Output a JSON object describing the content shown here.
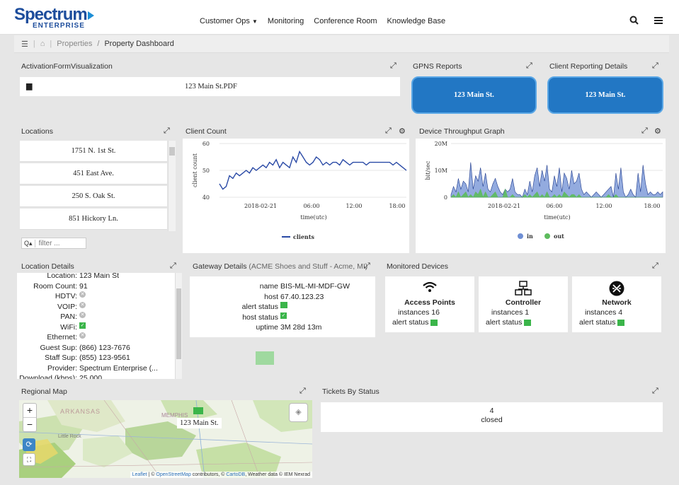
{
  "header": {
    "logo_top": "Spectrum",
    "logo_bottom": "ENTERPRISE",
    "nav": [
      "Customer Ops",
      "Monitoring",
      "Conference Room",
      "Knowledge Base"
    ],
    "search_icon": "search-icon",
    "menu_icon": "hamburger-menu-icon"
  },
  "breadcrumb": {
    "home_icon": "home-icon",
    "item1": "Properties",
    "sep": "/",
    "current": "Property Dashboard"
  },
  "activation": {
    "title": "ActivationFormVisualization",
    "file": "123 Main St.PDF"
  },
  "gpns": {
    "title": "GPNS Reports",
    "button": "123 Main St."
  },
  "client_reporting": {
    "title": "Client Reporting Details",
    "button": "123 Main St."
  },
  "locations": {
    "title": "Locations",
    "items": [
      "1751 N. 1st St.",
      "451 East Ave.",
      "250 S. Oak St.",
      "851 Hickory Ln."
    ],
    "filter_placeholder": "filter ..."
  },
  "client_count": {
    "title": "Client Count"
  },
  "throughput": {
    "title": "Device Throughput Graph"
  },
  "chart_data": [
    {
      "type": "line",
      "title": "Client Count",
      "xlabel": "time(utc)",
      "ylabel": "client count",
      "x_ticks": [
        "2018-02-21",
        "06:00",
        "12:00",
        "18:00"
      ],
      "y_ticks": [
        "40",
        "50",
        "60"
      ],
      "ylim": [
        40,
        60
      ],
      "series": [
        {
          "name": "clients",
          "color": "#2a4aa6",
          "values": [
            45,
            43,
            44,
            48,
            47,
            49,
            48,
            49,
            50,
            49,
            51,
            50,
            51,
            52,
            51,
            53,
            52,
            54,
            51,
            53,
            52,
            51,
            55,
            53,
            57,
            55,
            53,
            52,
            53,
            55,
            54,
            52,
            53,
            52,
            53,
            53,
            52,
            54,
            53,
            52,
            53,
            53,
            53,
            53,
            52,
            53,
            53,
            53,
            53,
            53,
            53,
            53,
            52,
            53,
            52,
            51,
            50
          ]
        }
      ],
      "legend": "bottom"
    },
    {
      "type": "area",
      "title": "Device Throughput Graph",
      "xlabel": "time(utc)",
      "ylabel": "bit/sec",
      "x_ticks": [
        "2018-02-21",
        "06:00",
        "12:00",
        "18:00"
      ],
      "y_ticks": [
        "0",
        "10M",
        "20M"
      ],
      "ylim": [
        0,
        20
      ],
      "series": [
        {
          "name": "in",
          "color": "#6f8fd4",
          "values": [
            1,
            4,
            2,
            7,
            3,
            6,
            5,
            2,
            13,
            3,
            8,
            6,
            11,
            4,
            9,
            3,
            2,
            5,
            7,
            4,
            2,
            1,
            3,
            2,
            3,
            7,
            2,
            1,
            1,
            0,
            3,
            1,
            6,
            2,
            8,
            11,
            4,
            10,
            6,
            12,
            3,
            2,
            8,
            4,
            11,
            2,
            9,
            7,
            3,
            10,
            5,
            6,
            9,
            3,
            1,
            2,
            1,
            0,
            1,
            2,
            1,
            0,
            1,
            2,
            3,
            4,
            0,
            9,
            3,
            11,
            2,
            0,
            1,
            3,
            1,
            0,
            9,
            2,
            12,
            5,
            1,
            2,
            1,
            1,
            2,
            1,
            2
          ]
        },
        {
          "name": "out",
          "color": "#5dbb5d",
          "values": [
            0,
            1,
            0,
            2,
            0,
            1,
            2,
            0,
            1,
            0,
            2,
            1,
            3,
            0,
            2,
            0,
            0,
            1,
            2,
            0,
            0,
            0,
            3,
            0,
            0,
            1,
            0,
            0,
            0,
            0,
            1,
            0,
            1,
            0,
            1,
            2,
            0,
            1,
            0,
            2,
            0,
            0,
            1,
            0,
            1,
            0,
            2,
            1,
            0,
            1,
            1,
            0,
            1,
            0,
            0,
            0,
            0,
            0,
            0,
            0,
            0,
            0,
            0,
            0,
            1,
            0,
            0,
            1,
            0,
            0,
            0,
            0,
            0,
            0,
            0,
            0,
            0,
            0,
            0,
            0,
            0,
            0,
            0,
            0,
            0,
            0,
            0
          ]
        }
      ],
      "legend": "bottom"
    }
  ],
  "location_details": {
    "title": "Location Details",
    "rows": [
      {
        "k": "Location:",
        "v": "123 Main St"
      },
      {
        "k": "Room Count:",
        "v": "91"
      },
      {
        "k": "HDTV:",
        "icon": "x"
      },
      {
        "k": "VOIP:",
        "icon": "x"
      },
      {
        "k": "PAN:",
        "icon": "x"
      },
      {
        "k": "WiFi:",
        "icon": "check"
      },
      {
        "k": "Ethernet:",
        "icon": "x"
      },
      {
        "k": "Guest Sup:",
        "v": "(866) 123-7676"
      },
      {
        "k": "Staff Sup:",
        "v": "(855) 123-9561"
      },
      {
        "k": "Provider:",
        "v": "Spectrum Enterprise (..."
      },
      {
        "k": "Download (kbps):",
        "v": "25.000"
      }
    ]
  },
  "gateway": {
    "title": "Gateway Details",
    "subtitle": "(ACME Shoes and Stuff - Acme, MI)",
    "rows": [
      {
        "k": "name",
        "v": "BIS-ML-MI-MDF-GW"
      },
      {
        "k": "host",
        "v": "67.40.123.23"
      },
      {
        "k": "alert status",
        "icon": "green-square"
      },
      {
        "k": "host status",
        "icon": "check"
      },
      {
        "k": "uptime",
        "v": "3M 28d 13m"
      }
    ]
  },
  "monitored": {
    "title": "Monitored Devices",
    "cards": [
      {
        "name": "Access Points",
        "icon": "wifi-icon",
        "instances_label": "instances",
        "instances": "16",
        "alert_label": "alert status"
      },
      {
        "name": "Controller",
        "icon": "controller-icon",
        "instances_label": "instances",
        "instances": "1",
        "alert_label": "alert status"
      },
      {
        "name": "Network",
        "icon": "network-icon",
        "instances_label": "instances",
        "instances": "4",
        "alert_label": "alert status"
      }
    ]
  },
  "map": {
    "title": "Regional Map",
    "zoom_in": "+",
    "zoom_out": "−",
    "label_state": "ARKANSAS",
    "label_city1": "MEMPHIS",
    "label_city2": "Little Rock",
    "popup": "123 Main St.",
    "attr_leaflet": "Leaflet",
    "attr_osm": "OpenStreetMap",
    "attr_mid": " contributors, © ",
    "attr_carto": "CartoDB",
    "attr_end": ", Weather data © IEM Nexrad",
    "attr_pre": " | © "
  },
  "tickets": {
    "title": "Tickets By Status",
    "count": "4",
    "status": "closed"
  }
}
